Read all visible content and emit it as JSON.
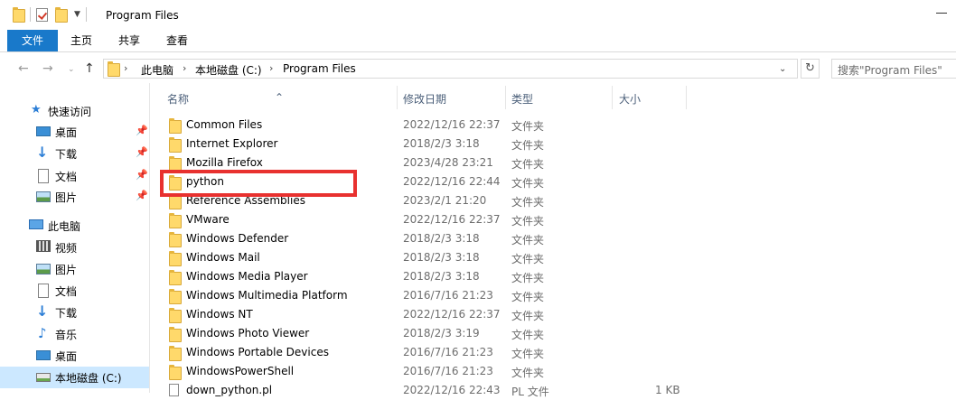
{
  "window": {
    "title": "Program Files"
  },
  "ribbon": {
    "tabs": [
      "文件",
      "主页",
      "共享",
      "查看"
    ]
  },
  "address": {
    "crumbs": [
      "此电脑",
      "本地磁盘 (C:)",
      "Program Files"
    ],
    "search_placeholder": "搜索\"Program Files\""
  },
  "navpane": {
    "quick_access": "快速访问",
    "pinned": [
      "桌面",
      "下载",
      "文档",
      "图片"
    ],
    "this_pc": "此电脑",
    "pc_items": [
      "视频",
      "图片",
      "文档",
      "下载",
      "音乐",
      "桌面",
      "本地磁盘 (C:)"
    ]
  },
  "columns": {
    "name": "名称",
    "date": "修改日期",
    "type": "类型",
    "size": "大小"
  },
  "files": [
    {
      "name": "Common Files",
      "date": "2022/12/16 22:37",
      "type": "文件夹",
      "size": "",
      "kind": "folder"
    },
    {
      "name": "Internet Explorer",
      "date": "2018/2/3 3:18",
      "type": "文件夹",
      "size": "",
      "kind": "folder"
    },
    {
      "name": "Mozilla Firefox",
      "date": "2023/4/28 23:21",
      "type": "文件夹",
      "size": "",
      "kind": "folder"
    },
    {
      "name": "python",
      "date": "2022/12/16 22:44",
      "type": "文件夹",
      "size": "",
      "kind": "folder"
    },
    {
      "name": "Reference Assemblies",
      "date": "2023/2/1 21:20",
      "type": "文件夹",
      "size": "",
      "kind": "folder"
    },
    {
      "name": "VMware",
      "date": "2022/12/16 22:37",
      "type": "文件夹",
      "size": "",
      "kind": "folder"
    },
    {
      "name": "Windows Defender",
      "date": "2018/2/3 3:18",
      "type": "文件夹",
      "size": "",
      "kind": "folder"
    },
    {
      "name": "Windows Mail",
      "date": "2018/2/3 3:18",
      "type": "文件夹",
      "size": "",
      "kind": "folder"
    },
    {
      "name": "Windows Media Player",
      "date": "2018/2/3 3:18",
      "type": "文件夹",
      "size": "",
      "kind": "folder"
    },
    {
      "name": "Windows Multimedia Platform",
      "date": "2016/7/16 21:23",
      "type": "文件夹",
      "size": "",
      "kind": "folder"
    },
    {
      "name": "Windows NT",
      "date": "2022/12/16 22:37",
      "type": "文件夹",
      "size": "",
      "kind": "folder"
    },
    {
      "name": "Windows Photo Viewer",
      "date": "2018/2/3 3:19",
      "type": "文件夹",
      "size": "",
      "kind": "folder"
    },
    {
      "name": "Windows Portable Devices",
      "date": "2016/7/16 21:23",
      "type": "文件夹",
      "size": "",
      "kind": "folder"
    },
    {
      "name": "WindowsPowerShell",
      "date": "2016/7/16 21:23",
      "type": "文件夹",
      "size": "",
      "kind": "folder"
    },
    {
      "name": "down_python.pl",
      "date": "2022/12/16 22:43",
      "type": "PL 文件",
      "size": "1 KB",
      "kind": "file"
    }
  ],
  "colors": {
    "accent": "#1979ca",
    "highlight": "#e8312f",
    "selection": "#cce8ff"
  }
}
